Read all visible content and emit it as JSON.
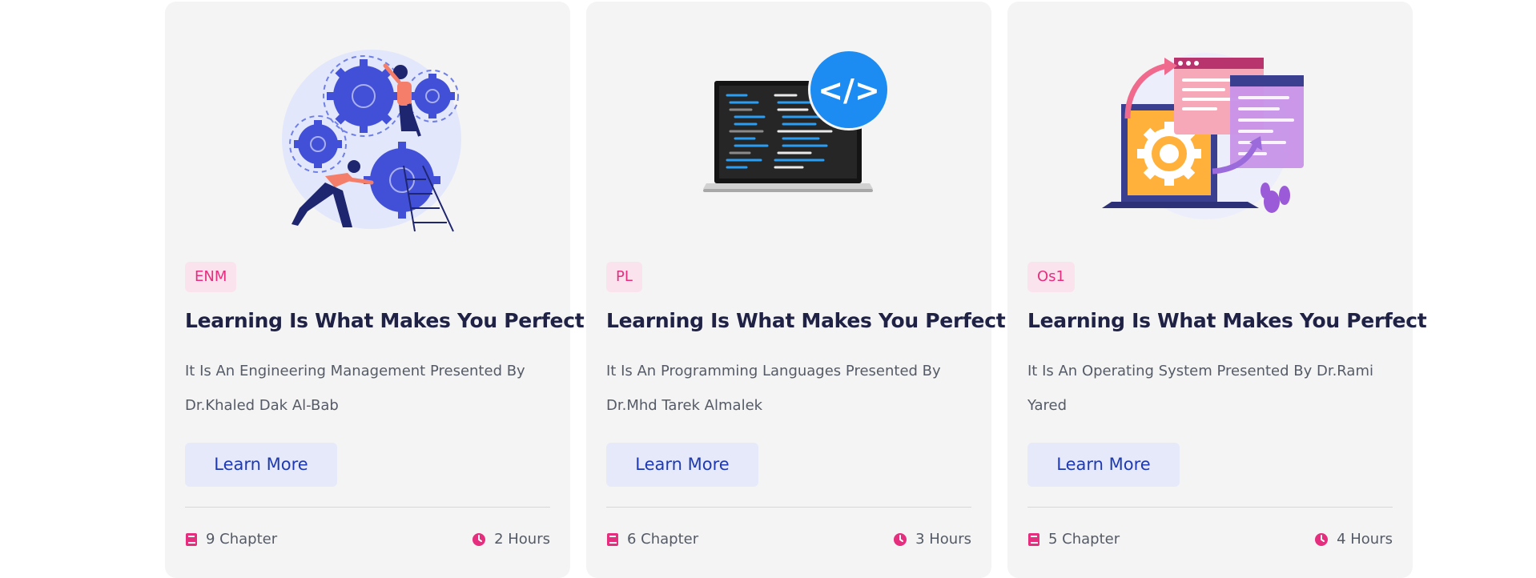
{
  "colors": {
    "card_bg": "#f4f4f4",
    "tag_bg": "#fbe3ee",
    "tag_text": "#e62e7e",
    "title": "#1f2245",
    "button_bg": "#e5e9fa",
    "button_text": "#1f3ab0",
    "icon": "#e62e7e"
  },
  "cards": [
    {
      "illustration": "gears-teamwork-illustration",
      "tag": "ENM",
      "title": "Learning Is What Makes You Perfect",
      "description": "It Is An Engineering Management Presented By Dr.Khaled Dak Al-Bab",
      "button": "Learn More",
      "chapters": "9 Chapter",
      "hours": "2 Hours"
    },
    {
      "illustration": "laptop-code-illustration",
      "tag": "PL",
      "title": "Learning Is What Makes You Perfect",
      "description": "It Is An Programming Languages Presented By Dr.Mhd Tarek Almalek",
      "button": "Learn More",
      "chapters": "6 Chapter",
      "hours": "3 Hours"
    },
    {
      "illustration": "laptop-windows-gear-illustration",
      "tag": "Os1",
      "title": "Learning Is What Makes You Perfect",
      "description": "It Is An Operating System Presented By Dr.Rami Yared",
      "button": "Learn More",
      "chapters": "5 Chapter",
      "hours": "4 Hours"
    }
  ]
}
